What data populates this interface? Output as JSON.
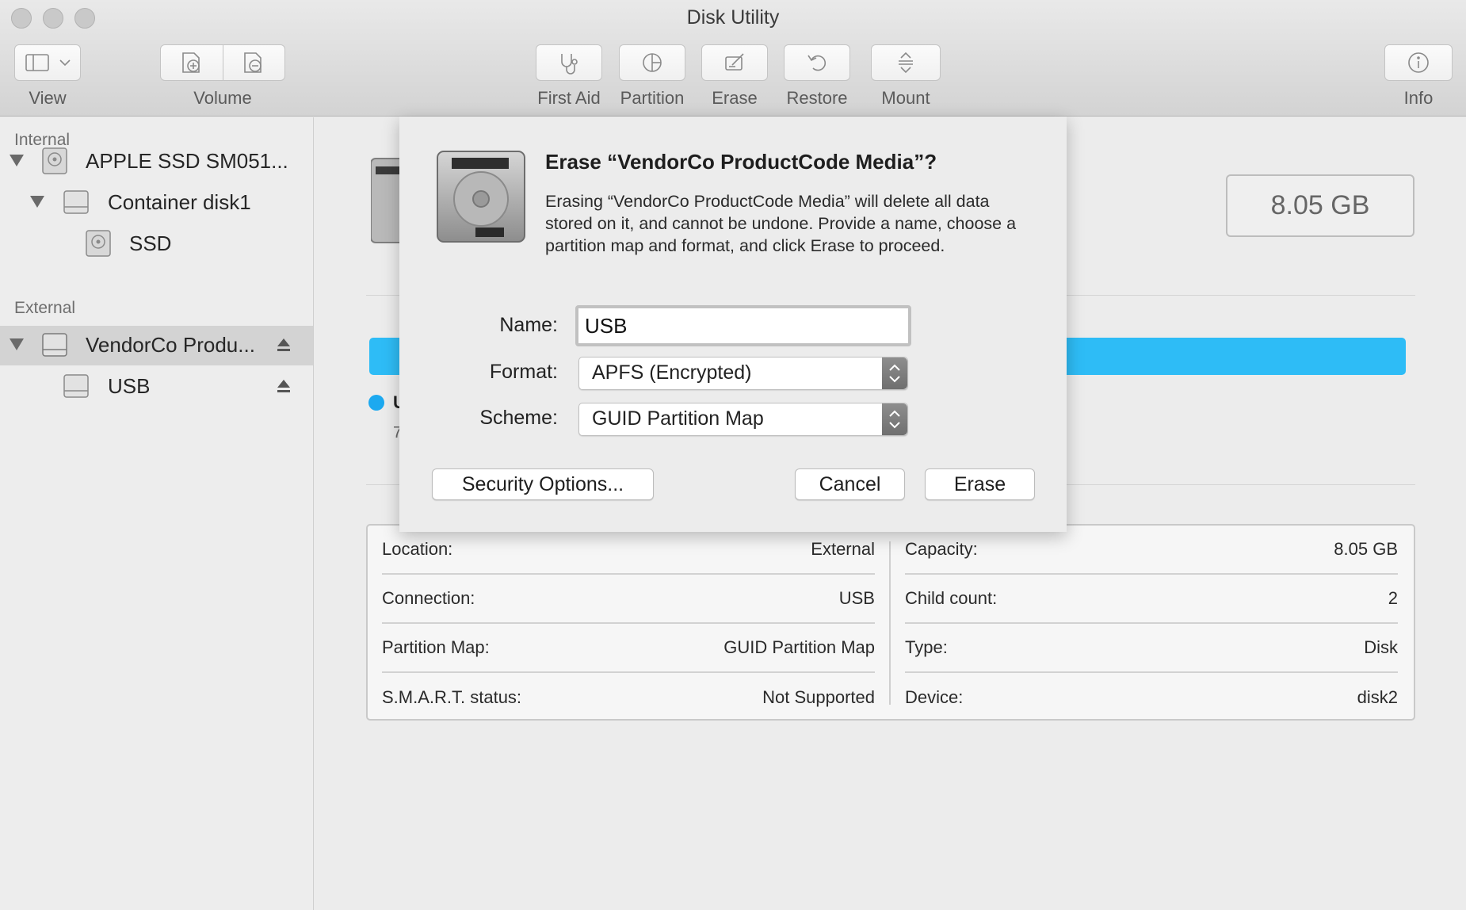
{
  "window": {
    "title": "Disk Utility"
  },
  "toolbar": {
    "view_label": "View",
    "volume_label": "Volume",
    "first_aid_label": "First Aid",
    "partition_label": "Partition",
    "erase_label": "Erase",
    "restore_label": "Restore",
    "mount_label": "Mount",
    "info_label": "Info"
  },
  "sidebar": {
    "internal_heading": "Internal",
    "external_heading": "External",
    "items": [
      {
        "label": "APPLE SSD SM051..."
      },
      {
        "label": "Container disk1"
      },
      {
        "label": "SSD"
      },
      {
        "label": "VendorCo Produ..."
      },
      {
        "label": "USB"
      }
    ]
  },
  "main": {
    "capacity": "8.05 GB",
    "legend_initial": "U",
    "legend_sub_initial": "7",
    "info": {
      "left": [
        {
          "key": "Location:",
          "value": "External"
        },
        {
          "key": "Connection:",
          "value": "USB"
        },
        {
          "key": "Partition Map:",
          "value": "GUID Partition Map"
        },
        {
          "key": "S.M.A.R.T. status:",
          "value": "Not Supported"
        }
      ],
      "right": [
        {
          "key": "Capacity:",
          "value": "8.05 GB"
        },
        {
          "key": "Child count:",
          "value": "2"
        },
        {
          "key": "Type:",
          "value": "Disk"
        },
        {
          "key": "Device:",
          "value": "disk2"
        }
      ]
    }
  },
  "dialog": {
    "title": "Erase “VendorCo ProductCode Media”?",
    "message": "Erasing “VendorCo ProductCode Media” will delete all data stored on it, and cannot be undone. Provide a name, choose a partition map and format, and click Erase to proceed.",
    "name_label": "Name:",
    "name_value": "USB",
    "format_label": "Format:",
    "format_value": "APFS (Encrypted)",
    "scheme_label": "Scheme:",
    "scheme_value": "GUID Partition Map",
    "security_button": "Security Options...",
    "cancel_button": "Cancel",
    "erase_button": "Erase"
  },
  "colors": {
    "usage_bar": "#2ebcf6",
    "accent": "#1ca9f0"
  }
}
